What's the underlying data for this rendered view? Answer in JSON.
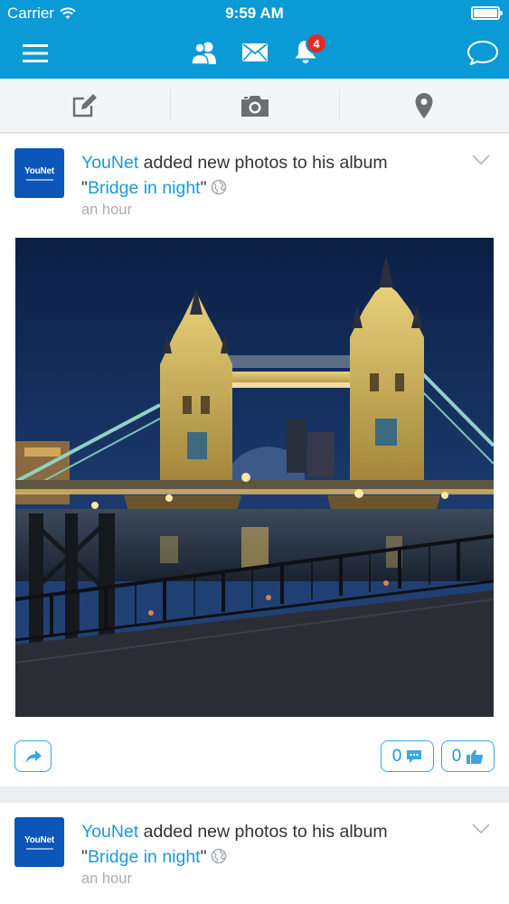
{
  "status_bar": {
    "carrier": "Carrier",
    "time": "9:59 AM"
  },
  "header": {
    "notification_count": "4",
    "accent_color": "#0a9bd6",
    "icons": [
      "menu-icon",
      "friends-icon",
      "mail-icon",
      "bell-icon",
      "chat-icon"
    ]
  },
  "composer": {
    "icons": [
      "edit-icon",
      "camera-icon",
      "location-pin-icon"
    ]
  },
  "feed": [
    {
      "avatar_text": "YouNet",
      "author": "YouNet",
      "action": " added new photos to his album",
      "album_open_quote": "\"",
      "album": "Bridge in night",
      "album_close_quote": "\"",
      "time_ago": "an hour",
      "comment_count": "0",
      "like_count": "0"
    },
    {
      "avatar_text": "YouNet",
      "author": "YouNet",
      "action": " added new photos to his album",
      "album_open_quote": "\"",
      "album": "Bridge in night",
      "album_close_quote": "\"",
      "time_ago": "an hour"
    }
  ]
}
